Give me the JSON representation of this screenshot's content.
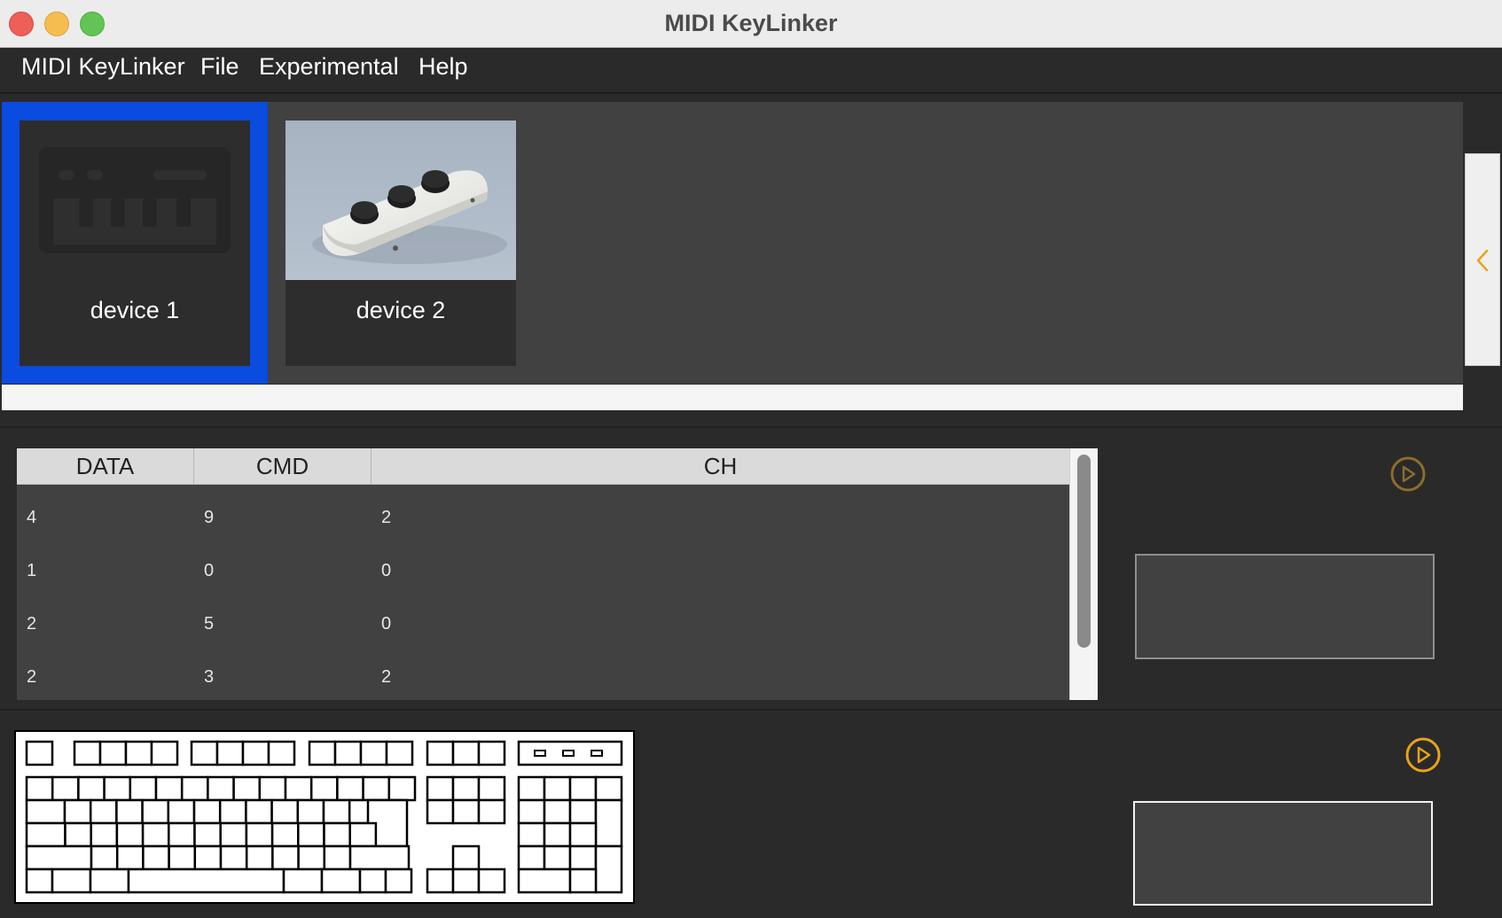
{
  "window": {
    "title": "MIDI KeyLinker"
  },
  "menu": {
    "items": [
      "MIDI KeyLinker",
      "File",
      "Experimental",
      "Help"
    ]
  },
  "devices": [
    {
      "name": "device 1",
      "selected": true,
      "icon": "midi-keyboard-icon"
    },
    {
      "name": "device 2",
      "selected": false,
      "icon": "knob-controller-photo"
    }
  ],
  "table": {
    "columns": [
      "DATA",
      "CMD",
      "CH"
    ],
    "rows": [
      [
        "4",
        "9",
        "2"
      ],
      [
        "1",
        "0",
        "0"
      ],
      [
        "2",
        "5",
        "0"
      ],
      [
        "2",
        "3",
        "2"
      ]
    ]
  },
  "controls": {
    "play_icon": "play-circle-icon",
    "collapse_icon": "chevron-left-icon"
  },
  "colors": {
    "accent": "#e8a317",
    "selection": "#0a4be0",
    "panel": "#414141",
    "background": "#2a2a2a"
  }
}
